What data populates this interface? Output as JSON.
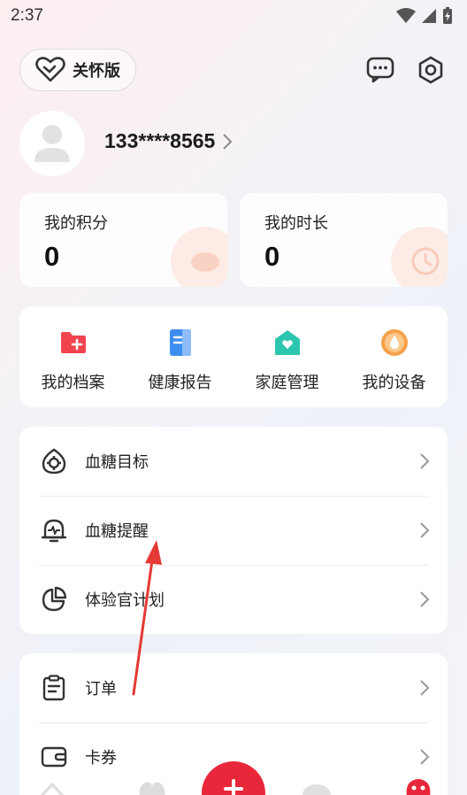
{
  "status": {
    "time": "2:37"
  },
  "header": {
    "care_mode_label": "关怀版"
  },
  "profile": {
    "phone": "133****8565"
  },
  "stats": [
    {
      "label": "我的积分",
      "value": "0"
    },
    {
      "label": "我的时长",
      "value": "0"
    }
  ],
  "quick_actions": [
    {
      "label": "我的档案",
      "icon": "folder-plus-icon",
      "color": "#f0454f"
    },
    {
      "label": "健康报告",
      "icon": "report-icon",
      "color": "#3d8ef0"
    },
    {
      "label": "家庭管理",
      "icon": "home-heart-icon",
      "color": "#2cc6b0"
    },
    {
      "label": "我的设备",
      "icon": "device-icon",
      "color": "#f5a04a"
    }
  ],
  "menu_group1": [
    {
      "label": "血糖目标",
      "icon": "target-icon"
    },
    {
      "label": "血糖提醒",
      "icon": "bell-pulse-icon"
    },
    {
      "label": "体验官计划",
      "icon": "pie-chart-icon"
    }
  ],
  "menu_group2": [
    {
      "label": "订单",
      "icon": "clipboard-icon"
    },
    {
      "label": "卡券",
      "icon": "wallet-icon"
    }
  ],
  "colors": {
    "accent": "#e8283a",
    "annotation_arrow": "#e53935"
  }
}
